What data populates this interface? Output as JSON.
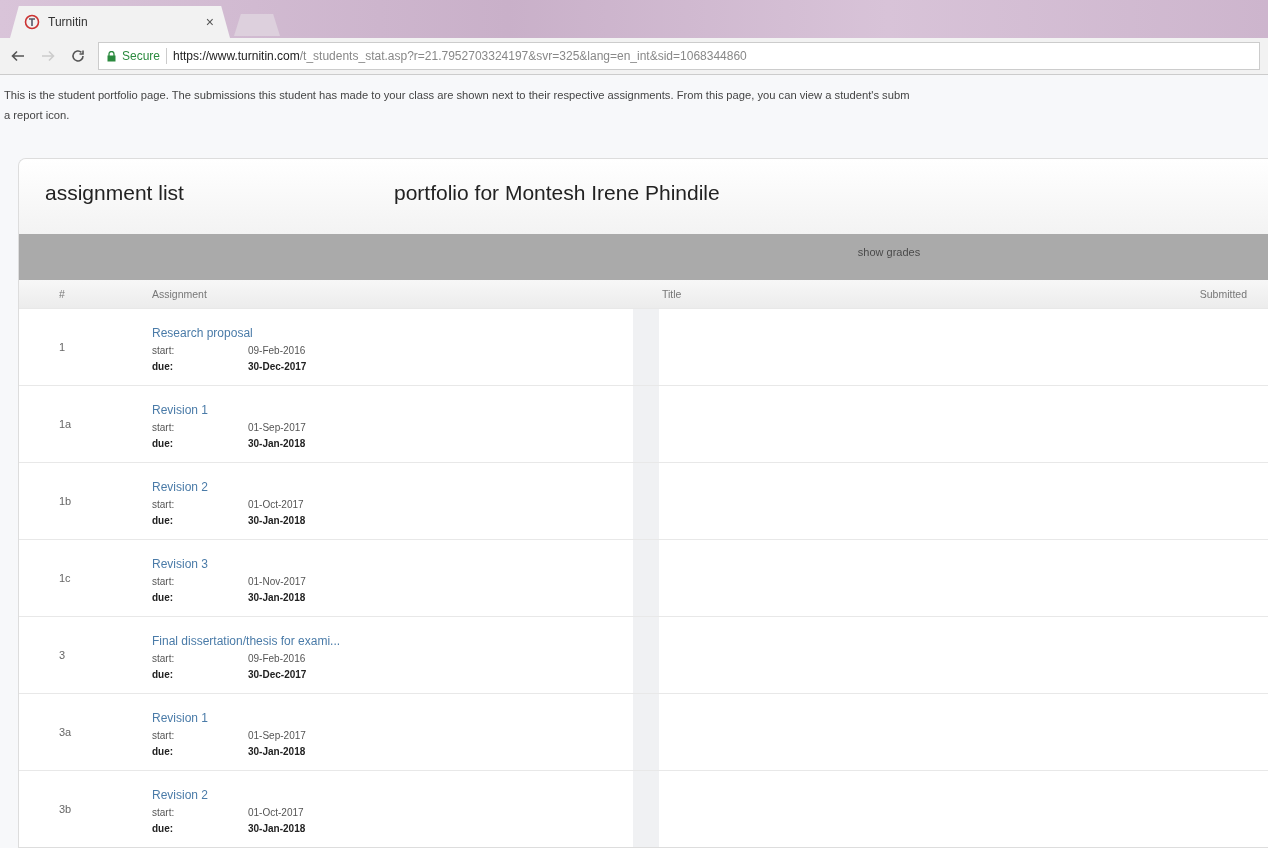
{
  "browser": {
    "tab": {
      "title": "Turnitin",
      "close": "×",
      "selected": true
    },
    "secure_label": "Secure",
    "url_host": "https://www.turnitin.com",
    "url_path": "/t_students_stat.asp?r=21.7952703324197&svr=325&lang=en_int&sid=1068344860"
  },
  "intro": [
    "This is the student portfolio page. The submissions this student has made to your class are shown next to their respective assignments. From this page, you can view a student's subm",
    "a report icon."
  ],
  "card": {
    "heading": "assignment list",
    "subheading": "portfolio for Montesh Irene Phindile",
    "grades_button": "show grades",
    "columns": [
      "#",
      "Assignment",
      "Title",
      "Submitted"
    ],
    "rows": [
      {
        "number": "1",
        "title": "Research proposal",
        "start_label": "start:",
        "start": "09-Feb-2016",
        "due_label": "due:",
        "due": "30-Dec-2017"
      },
      {
        "number": "1a",
        "title": "Revision 1",
        "start_label": "start:",
        "start": "01-Sep-2017",
        "due_label": "due:",
        "due": "30-Jan-2018"
      },
      {
        "number": "1b",
        "title": "Revision 2",
        "start_label": "start:",
        "start": "01-Oct-2017",
        "due_label": "due:",
        "due": "30-Jan-2018"
      },
      {
        "number": "1c",
        "title": "Revision 3",
        "start_label": "start:",
        "start": "01-Nov-2017",
        "due_label": "due:",
        "due": "30-Jan-2018"
      },
      {
        "number": "3",
        "title": "Final dissertation/thesis for exami...",
        "start_label": "start:",
        "start": "09-Feb-2016",
        "due_label": "due:",
        "due": "30-Dec-2017"
      },
      {
        "number": "3a",
        "title": "Revision 1",
        "start_label": "start:",
        "start": "01-Sep-2017",
        "due_label": "due:",
        "due": "30-Jan-2018"
      },
      {
        "number": "3b",
        "title": "Revision 2",
        "start_label": "start:",
        "start": "01-Oct-2017",
        "due_label": "due:",
        "due": "30-Jan-2018"
      }
    ]
  }
}
